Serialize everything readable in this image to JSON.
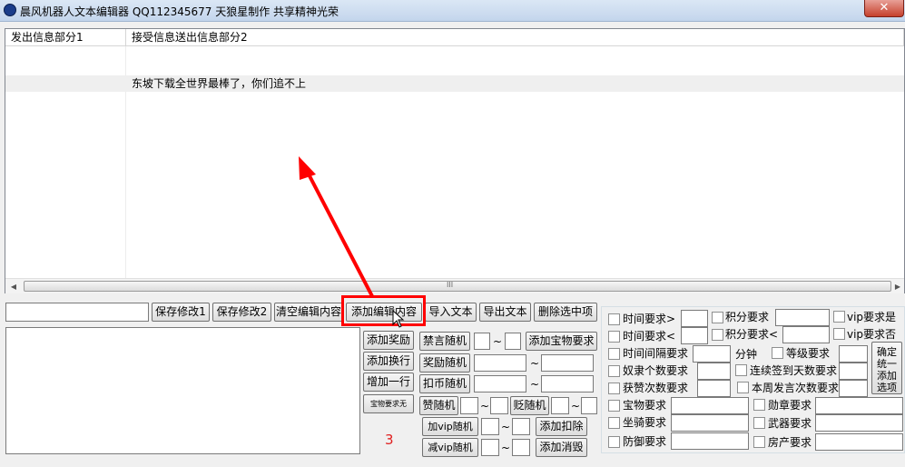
{
  "window": {
    "title": "晨风机器人文本编辑器   QQ112345677 天狼星制作   共享精神光荣",
    "close_glyph": "✕"
  },
  "list": {
    "columns": [
      "发出信息部分1",
      "接受信息送出信息部分2"
    ],
    "rows": [
      {
        "col1": "",
        "col2": "东坡下载全世界最棒了，你们追不上"
      }
    ],
    "scroll_grip": "III",
    "scroll_left": "◀",
    "scroll_right": "▶"
  },
  "toolbar": {
    "save1": "保存修改1",
    "save2": "保存修改2",
    "clear": "清空编辑内容",
    "add_edit": "添加编辑内容",
    "import": "导入文本",
    "export": "导出文本",
    "delete": "删除选中项"
  },
  "left_buttons": {
    "add_reward": "添加奖励",
    "add_newline": "添加换行",
    "add_row": "增加一行",
    "treasure_none": "宝物要求无"
  },
  "mid": {
    "mute_random": "禁言随机",
    "reward_random": "奖励随机",
    "deduct_coin_random": "扣币随机",
    "praise_random": "赞随机",
    "demote_random": "贬随机",
    "add_vip_random": "加vip随机",
    "sub_vip_random": "减vip随机",
    "tilde": "~",
    "add_treasure_req": "添加宝物要求",
    "add_deduct": "添加扣除",
    "add_consume": "添加消毁",
    "note": "3"
  },
  "conditions": {
    "time_gt": "时间要求>",
    "score_req": "积分要求",
    "vip_yes": "vip要求是",
    "time_lt": "时间要求<",
    "score_lt": "积分要求<",
    "vip_no": "vip要求否",
    "time_interval": "时间间隔要求",
    "minutes": "分钟",
    "level_req": "等级要求",
    "slave_count": "奴隶个数要求",
    "consecutive_signin": "连续签到天数要求",
    "praised_count": "获赞次数要求",
    "week_speech": "本周发言次数要求",
    "treasure_req": "宝物要求",
    "medal_req": "勋章要求",
    "mount_req": "坐骑要求",
    "weapon_req": "武器要求",
    "defense_req": "防御要求",
    "property_req": "房产要求",
    "confirm_unified": "确定统一添加选项"
  }
}
